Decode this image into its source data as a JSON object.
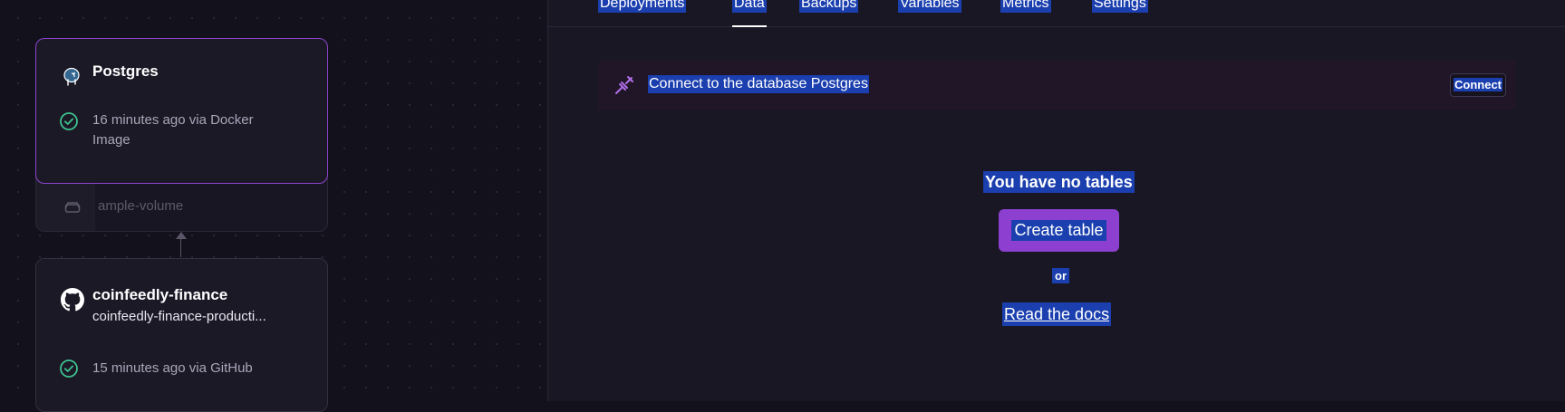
{
  "canvas": {
    "postgres": {
      "name": "Postgres",
      "icon": "postgres-elephant-icon",
      "status": "16 minutes ago via Docker Image",
      "status_icon": "check-circle-icon"
    },
    "volume": {
      "name": "ample-volume",
      "icon": "hard-drive-icon"
    },
    "service": {
      "name": "coinfeedly-finance",
      "domain": "coinfeedly-finance-producti...",
      "icon": "github-icon",
      "status": "15 minutes ago via GitHub",
      "status_icon": "check-circle-icon"
    }
  },
  "tabs": [
    {
      "label": "Deployments"
    },
    {
      "label": "Data",
      "active": true
    },
    {
      "label": "Backups"
    },
    {
      "label": "Variables"
    },
    {
      "label": "Metrics"
    },
    {
      "label": "Settings"
    }
  ],
  "banner": {
    "icon": "plug-connect-icon",
    "text": "Connect to the database Postgres",
    "button": "Connect"
  },
  "empty_state": {
    "title": "You have no tables",
    "create_button": "Create table",
    "or_text": "or",
    "docs_link": "Read the docs"
  },
  "colors": {
    "accent": "#8d3fd0",
    "success": "#3ec28f",
    "selection": "#1b3fae",
    "background": "#13111c"
  }
}
